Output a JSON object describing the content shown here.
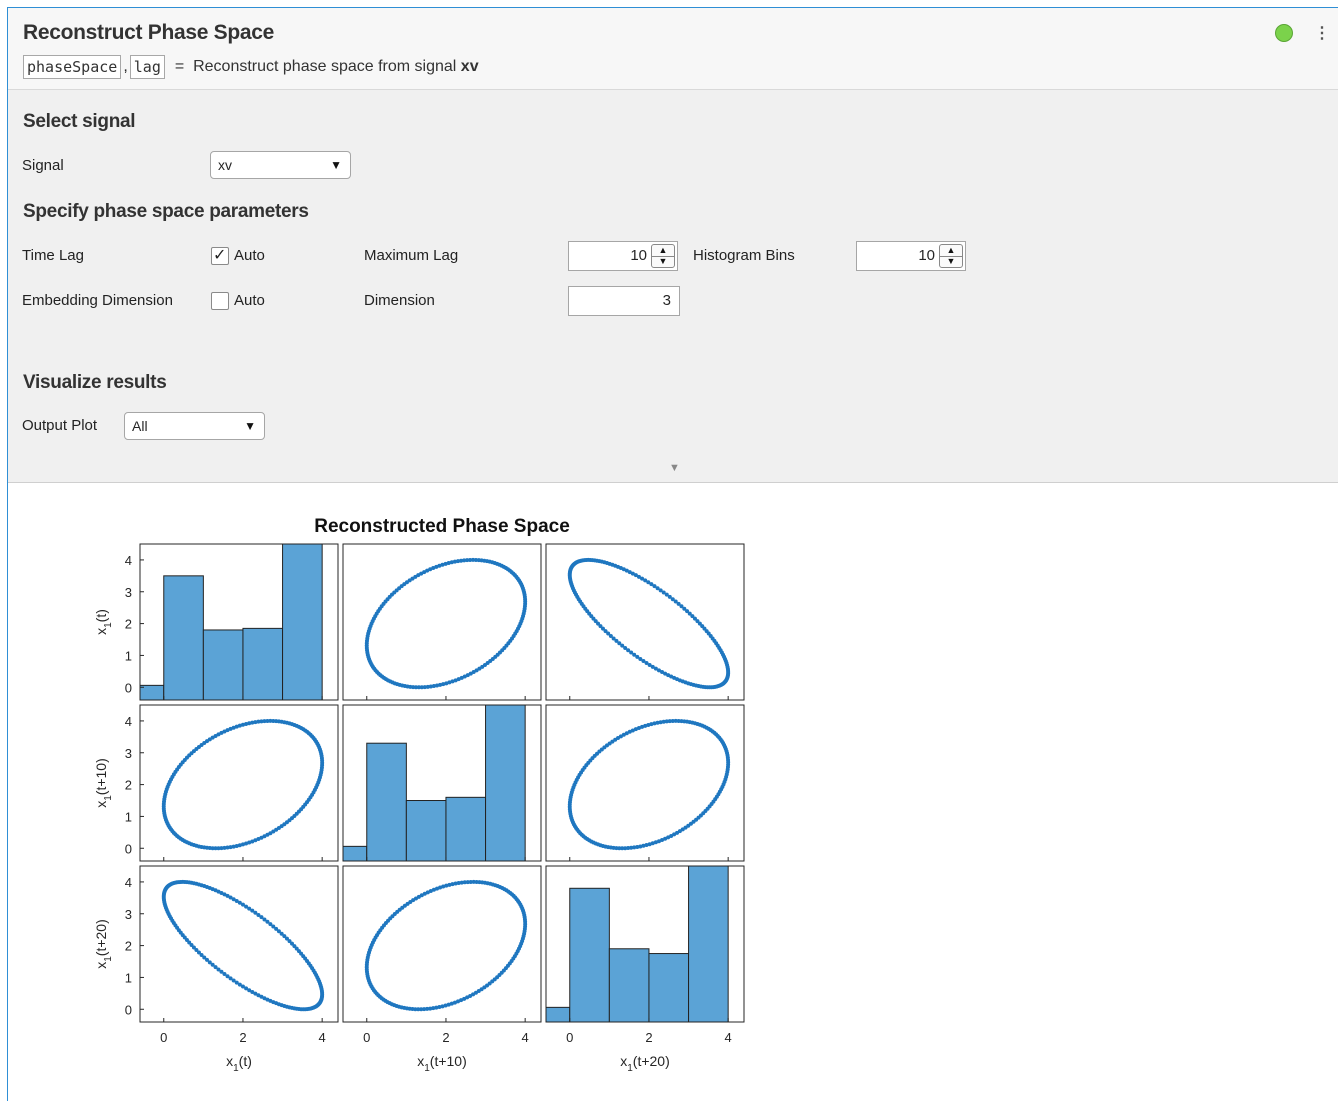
{
  "task": {
    "title": "Reconstruct Phase Space",
    "outputs": [
      "phaseSpace",
      "lag"
    ],
    "equals": "=",
    "description_prefix": "Reconstruct phase space from signal",
    "signal_name": "xv",
    "status_color": "#7bd24b"
  },
  "sections": {
    "select_signal": "Select signal",
    "parameters": "Specify phase space parameters",
    "visualize": "Visualize results"
  },
  "signal": {
    "label": "Signal",
    "value": "xv"
  },
  "time_lag": {
    "label": "Time Lag",
    "auto_label": "Auto",
    "auto_checked": true
  },
  "max_lag": {
    "label": "Maximum Lag",
    "value": "10"
  },
  "hist_bins": {
    "label": "Histogram Bins",
    "value": "10"
  },
  "embedding": {
    "label": "Embedding Dimension",
    "auto_label": "Auto",
    "auto_checked": false
  },
  "dimension": {
    "label": "Dimension",
    "value": "3"
  },
  "output_plot": {
    "label": "Output Plot",
    "value": "All"
  },
  "icons": {
    "status": "status-dot-icon",
    "menu": "kebab-menu-icon",
    "dropdown": "chevron-down-icon",
    "collapse": "collapse-arrow-icon"
  },
  "chart_data": {
    "type": "scatter",
    "title": "Reconstructed Phase Space",
    "variables": [
      "x1(t)",
      "x1(t+10)",
      "x1(t+20)"
    ],
    "axis_labels": {
      "x": [
        {
          "base": "x",
          "sub": "1",
          "suffix": "(t)"
        },
        {
          "base": "x",
          "sub": "1",
          "suffix": "(t+10)"
        },
        {
          "base": "x",
          "sub": "1",
          "suffix": "(t+20)"
        }
      ],
      "y": [
        {
          "base": "x",
          "sub": "1",
          "suffix": "(t)"
        },
        {
          "base": "x",
          "sub": "1",
          "suffix": "(t+10)"
        },
        {
          "base": "x",
          "sub": "1",
          "suffix": "(t+20)"
        }
      ]
    },
    "xlim": [
      -0.6,
      4.4
    ],
    "ylim": [
      -0.4,
      4.5
    ],
    "x_ticks": [
      0,
      2,
      4
    ],
    "y_ticks": [
      0,
      1,
      2,
      3,
      4
    ],
    "bar_color": "#5ba3d6",
    "point_color": "#1f77c0",
    "histograms": [
      {
        "edges": [
          -0.6,
          0,
          1,
          2,
          3,
          4
        ],
        "heights": [
          0.06,
          3.5,
          1.8,
          1.85,
          4.5
        ]
      },
      {
        "edges": [
          -0.6,
          0,
          1,
          2,
          3,
          4
        ],
        "heights": [
          0.06,
          3.3,
          1.5,
          1.6,
          4.5
        ]
      },
      {
        "edges": [
          -0.6,
          0,
          1,
          2,
          3,
          4
        ],
        "heights": [
          0.06,
          3.8,
          1.9,
          1.75,
          4.5
        ]
      }
    ],
    "attractor": {
      "center_x": 2.0,
      "center_y": 2.0,
      "radius_x": 2.0,
      "radius_y": 1.9,
      "lag_phase_deg": {
        "10": 70,
        "20": 140
      },
      "samples": 160
    }
  }
}
